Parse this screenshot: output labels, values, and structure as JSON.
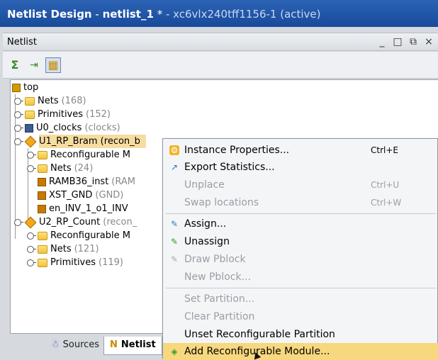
{
  "window": {
    "title_main": "Netlist Design",
    "title_sep": " - ",
    "title_file": "netlist_1",
    "title_modified": " * ",
    "title_device": "- xc6vlx240tff1156-1 (active)"
  },
  "panel": {
    "title": "Netlist",
    "controls": [
      "_",
      "□",
      "⧉",
      "×"
    ]
  },
  "toolbar": {
    "buttons": [
      {
        "icon": "sigma-icon",
        "glyph": "Σ"
      },
      {
        "icon": "expand-all-icon",
        "glyph": "⇥"
      },
      {
        "icon": "pin-icon",
        "glyph": "▦"
      }
    ]
  },
  "tree": {
    "rows": [
      {
        "label": "top",
        "count": ""
      },
      {
        "label": "Nets",
        "count": "(168)"
      },
      {
        "label": "Primitives",
        "count": "(152)"
      },
      {
        "label": "U0_clocks",
        "count": "(clocks)"
      },
      {
        "label": "U1_RP_Bram (recon_b",
        "count": ""
      },
      {
        "label": "Reconfigurable M",
        "count": ""
      },
      {
        "label": "Nets",
        "count": "(24)"
      },
      {
        "label": "RAMB36_inst",
        "count": "(RAM"
      },
      {
        "label": "XST_GND",
        "count": "(GND)"
      },
      {
        "label": "en_INV_1_o1_INV",
        "count": ""
      },
      {
        "label": "U2_RP_Count",
        "count": "(recon_"
      },
      {
        "label": "Reconfigurable M",
        "count": ""
      },
      {
        "label": "Nets",
        "count": "(121)"
      },
      {
        "label": "Primitives",
        "count": "(119)"
      }
    ]
  },
  "tabs": {
    "sources": "Sources",
    "netlist": "Netlist"
  },
  "context_menu": {
    "items": [
      {
        "label": "Instance Properties...",
        "shortcut": "Ctrl+E",
        "icon": "properties-icon",
        "disabled": false
      },
      {
        "label": "Export Statistics...",
        "shortcut": "",
        "icon": "export-icon",
        "disabled": false
      },
      {
        "label": "Unplace",
        "shortcut": "Ctrl+U",
        "icon": "",
        "disabled": true
      },
      {
        "label": "Swap locations",
        "shortcut": "Ctrl+W",
        "icon": "",
        "disabled": true
      },
      {
        "label": "Assign...",
        "shortcut": "",
        "icon": "assign-icon",
        "disabled": false
      },
      {
        "label": "Unassign",
        "shortcut": "",
        "icon": "unassign-icon",
        "disabled": false
      },
      {
        "label": "Draw Pblock",
        "shortcut": "",
        "icon": "draw-pblock-icon",
        "disabled": true
      },
      {
        "label": "New Pblock...",
        "shortcut": "",
        "icon": "",
        "disabled": true
      },
      {
        "label": "Set Partition...",
        "shortcut": "",
        "icon": "",
        "disabled": true
      },
      {
        "label": "Clear Partition",
        "shortcut": "",
        "icon": "",
        "disabled": true
      },
      {
        "label": "Unset Reconfigurable Partition",
        "shortcut": "",
        "icon": "",
        "disabled": false
      },
      {
        "label": "Add Reconfigurable Module...",
        "shortcut": "",
        "icon": "add-module-icon",
        "disabled": false
      }
    ]
  },
  "colors": {
    "titlebar": "#1f55a8",
    "selection": "#f6dca0",
    "menu_highlight": "#f8d87e"
  }
}
